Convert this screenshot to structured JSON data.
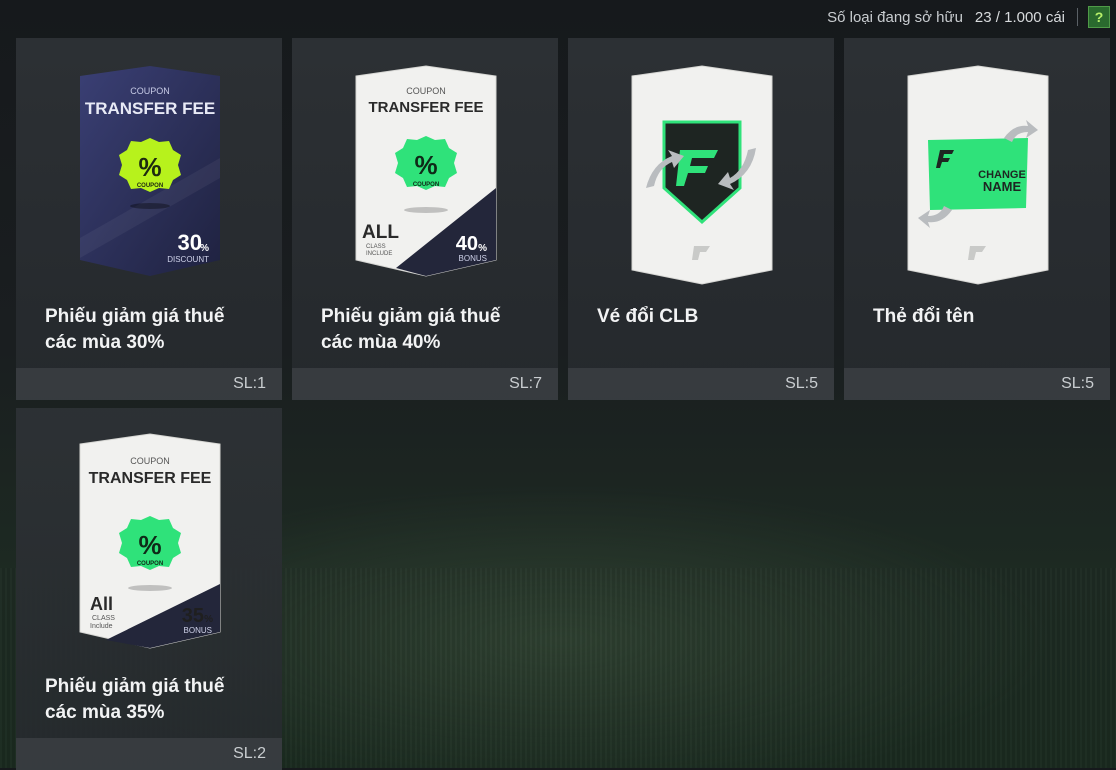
{
  "header": {
    "owned_label": "Số loại đang sở hữu",
    "owned_count": "23 / 1.000 cái",
    "help_label": "?"
  },
  "coupon_text": {
    "coupon": "COUPON",
    "transfer_fee": "TRANSFER FEE",
    "badge_coupon": "COUPON",
    "percent_symbol": "%",
    "all": "ALL",
    "all_alt": "All",
    "class_include": "CLASS",
    "include": "INCLUDE",
    "include_alt": "Include",
    "discount": "DISCOUNT",
    "bonus": "BONUS",
    "change_name_1": "CHANGE",
    "change_name_2": "NAME"
  },
  "items": [
    {
      "title": "Phiếu giảm giá thuế các mùa 30%",
      "qty": "SL:1",
      "value": "30",
      "unit": "%"
    },
    {
      "title": "Phiếu giảm giá thuế các mùa 40%",
      "qty": "SL:7",
      "value": "40",
      "unit": "%"
    },
    {
      "title": "Vé đổi CLB",
      "qty": "SL:5"
    },
    {
      "title": "Thẻ đổi tên",
      "qty": "SL:5"
    },
    {
      "title": "Phiếu giảm giá thuế các mùa 35%",
      "qty": "SL:2",
      "value": "35",
      "unit": "%"
    }
  ],
  "colors": {
    "accent_green": "#2fe27a",
    "lime_badge": "#b7f21c",
    "dark_card": "#2b2f5a"
  }
}
